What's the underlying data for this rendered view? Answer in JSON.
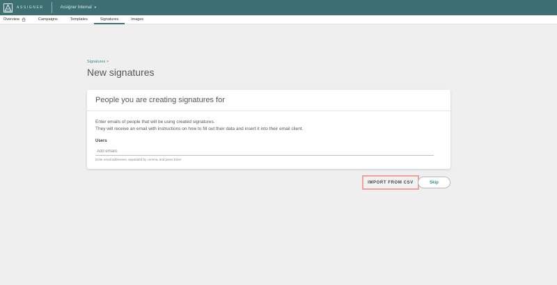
{
  "app": {
    "brand": "ASSIGNER",
    "workspace": "Assigner Internal"
  },
  "nav": {
    "tabs": [
      {
        "label": "Overview"
      },
      {
        "label": "Campaigns"
      },
      {
        "label": "Templates"
      },
      {
        "label": "Signatures",
        "active": true
      },
      {
        "label": "Images"
      }
    ]
  },
  "page": {
    "breadcrumb": "Signatures >",
    "title": "New signatures"
  },
  "card": {
    "title": "People you are creating signatures for",
    "desc_line1": "Enter emails of people that will be using created signatures.",
    "desc_line2": "They will receive an email with instructions on how to fill out their data and insert it into their email client.",
    "users_label": "Users",
    "email_placeholder": "Add emails",
    "email_value": "",
    "hint": "Enter email addresses, separated by comma, and press Enter"
  },
  "actions": {
    "import_csv": "IMPORT FROM CSV",
    "skip": "Skip"
  },
  "colors": {
    "topbar": "#3d6f73",
    "accent": "#2f8b8b",
    "highlight_border": "#eca39a"
  },
  "icons": {
    "logo": "assigner-logo-icon",
    "workspace_dropdown": "chevron-down-icon",
    "overview": "home-icon"
  }
}
